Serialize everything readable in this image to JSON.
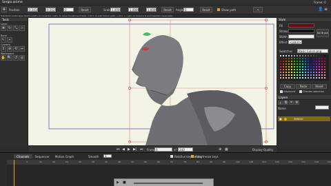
{
  "window": {
    "title": "Sergio.anime",
    "frame_label": "Frame: 0"
  },
  "toolbar": {
    "position_label": "Position",
    "position_x": "0.3438",
    "position_y": "0.5025",
    "position_z": "0",
    "reset1": "Reset",
    "scale_label": "Scale",
    "scale_x": "1.0000",
    "scale_y": "1.0000",
    "scale_z": "1.0000",
    "reset2": "Reset",
    "angle_label": "Angle",
    "angle_value": "0",
    "reset3": "Reset",
    "show_path": "Show path"
  },
  "statusbar": {
    "hint": "Transform entire layer (hold <shift> to constrain, <alt> to move forward and back, <ctrl> to edit motion path, <ctrl> + <alt> to move in Z and maintain visual size)"
  },
  "left": {
    "tools_title": "Tools",
    "sections": [
      "Layer",
      "Bone",
      "Camera",
      "Workspace"
    ]
  },
  "right": {
    "style_title": "Style",
    "fill_label": "Fill",
    "stroke_label": "Stroke",
    "width_label": "Width",
    "effect_label": "Effect",
    "effect_value": "<plain>",
    "no_brush": "No Brush",
    "swatches_label": "Swatches",
    "swatches_value": "Basic Colors.png",
    "copy": "Copy",
    "paste": "Paste",
    "reset": "Reset",
    "advanced": "Advanced",
    "checker": "Checker selection",
    "layers_title": "Layers",
    "name_label": "Name",
    "layer_name": "SERGIO"
  },
  "playback": {
    "frame_label": "Frame",
    "frame_value": "0",
    "of": "of",
    "end_value": "240",
    "display_quality": "Display Quality"
  },
  "timeline": {
    "tabs": [
      "Channels",
      "Sequencer",
      "Motion Graph"
    ],
    "smooth": "Smooth",
    "one": "1",
    "relative": "Relative keyframing",
    "autofreeze": "Auto-freeze keys",
    "ticks": [
      "6",
      "12",
      "18",
      "24",
      "30",
      "36",
      "42",
      "48",
      "54",
      "60",
      "66",
      "72",
      "78",
      "84",
      "90",
      "96",
      "102",
      "108",
      "114",
      "120",
      "126",
      "132",
      "138",
      "144"
    ]
  },
  "colors": {
    "accent": "#f0a020",
    "canvas": "#f4f4e6",
    "selection": "#7a6a1a"
  }
}
